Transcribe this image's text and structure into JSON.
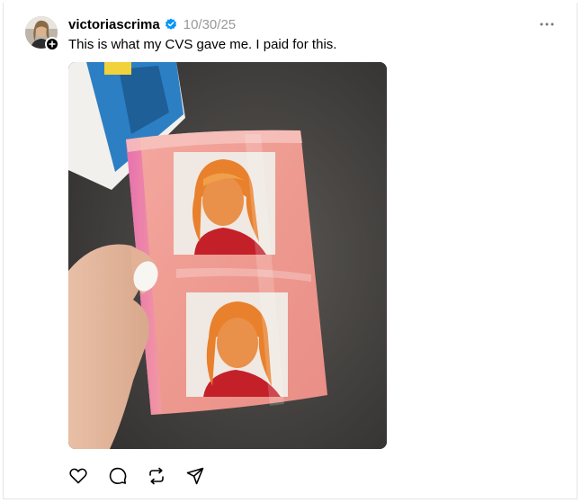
{
  "post": {
    "username": "victoriascrima",
    "date": "10/30/25",
    "caption": "This is what my CVS gave me. I paid for this.",
    "verified": true
  },
  "icons": {
    "more": "more-horizontal-icon",
    "like": "heart-icon",
    "reply": "comment-icon",
    "repost": "repost-icon",
    "share": "send-icon",
    "verified": "verified-badge-icon",
    "follow": "plus-icon"
  },
  "colors": {
    "verified_blue": "#0095f6",
    "muted_text": "#999999",
    "photo_print_pink": "#f0a090"
  }
}
